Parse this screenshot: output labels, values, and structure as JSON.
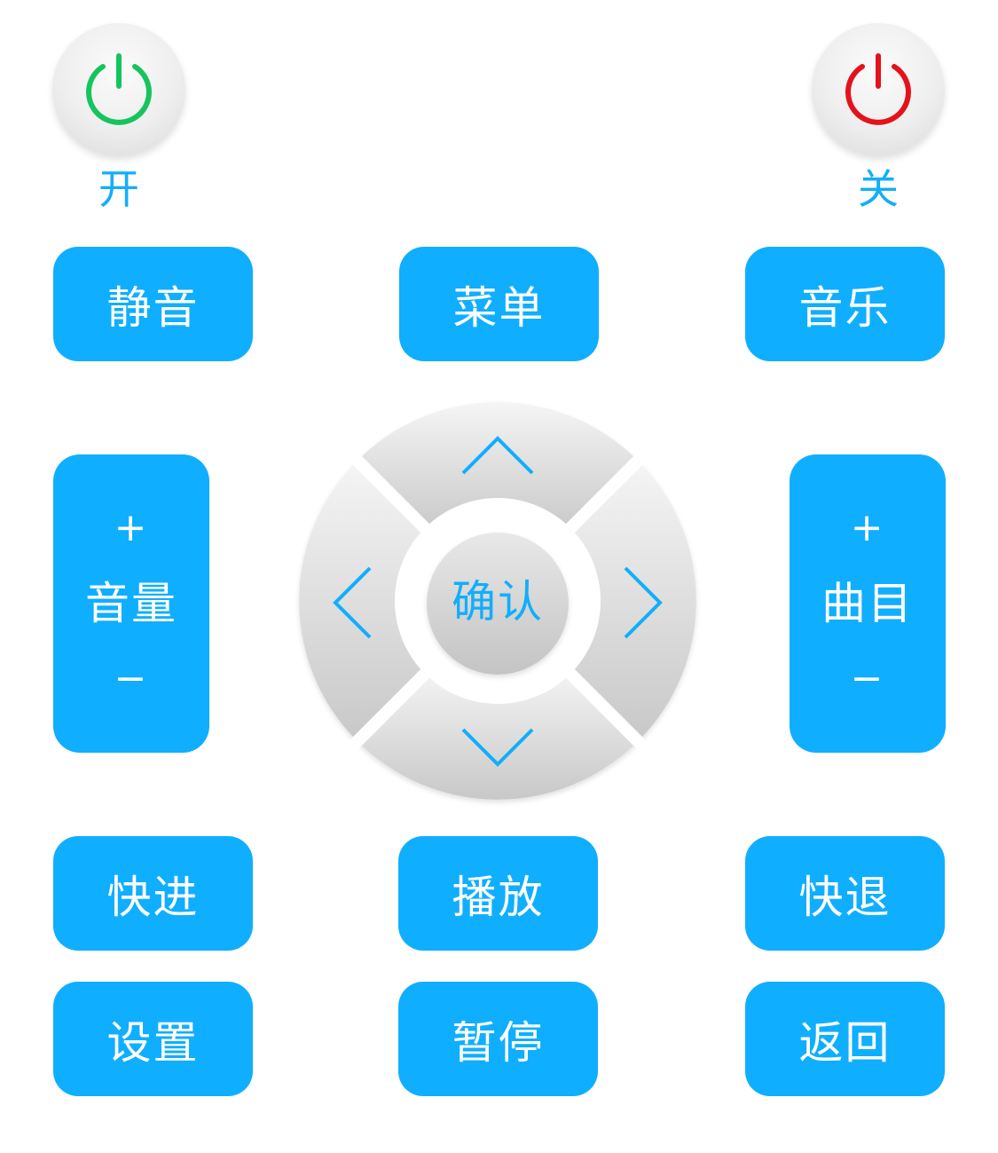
{
  "power": {
    "on_label": "开",
    "off_label": "关",
    "on_color": "#16c45e",
    "off_color": "#e3131b",
    "on_icon": "power-icon",
    "off_icon": "power-icon"
  },
  "row1": {
    "mute": "静音",
    "menu": "菜单",
    "music": "音乐"
  },
  "volume": {
    "plus": "+",
    "label": "音量",
    "minus": "−"
  },
  "track": {
    "plus": "+",
    "label": "曲目",
    "minus": "−"
  },
  "dpad": {
    "confirm": "确认",
    "up_icon": "chevron-up-icon",
    "down_icon": "chevron-down-icon",
    "left_icon": "chevron-left-icon",
    "right_icon": "chevron-right-icon"
  },
  "row3": {
    "fast_forward": "快进",
    "play": "播放",
    "rewind": "快退"
  },
  "row4": {
    "settings": "设置",
    "pause": "暂停",
    "back": "返回"
  },
  "colors": {
    "accent": "#10aeff",
    "label_text": "#12aefa",
    "button_text": "#ffffff",
    "dpad_light": "#f4f4f4",
    "dpad_dark": "#c9c9c9"
  }
}
